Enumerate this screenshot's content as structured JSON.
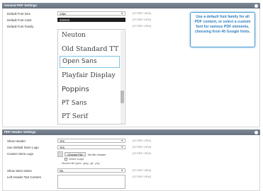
{
  "general": {
    "title": "General PDF Settings",
    "rows": [
      {
        "label": "Default Font Size",
        "value": "14px",
        "scope": "[STORE VIEW]"
      },
      {
        "label": "Default Font Color",
        "value": "333333",
        "scope": "[STORE VIEW]"
      },
      {
        "label": "Default Font Family",
        "scope": "[STORE VIEW]"
      }
    ],
    "font_options": [
      "Neuton",
      "Old Standard TT",
      "Open Sans",
      "Playfair Display",
      "Poppins",
      "PT Sans",
      "PT Serif"
    ],
    "selected_font": "Open Sans",
    "tooltip": "Use a default font family for all PDF content, or select a custom font for various PDF elements, choosing from 40 Google fonts."
  },
  "header": {
    "title": "PDF Header Settings",
    "show_header": {
      "label": "Show Header",
      "value": "Yes",
      "scope": "[STORE VIEW]"
    },
    "default_logo": {
      "label": "Use Default Store Logo",
      "value": "Yes",
      "scope": "[STORE VIEW]"
    },
    "custom_logo": {
      "label": "Custom Store Logo",
      "button": "Choose File",
      "file_text": "No file chosen",
      "delete_label": "Delete Image",
      "allowed": "Allowed file types: .jpeg, .gif, .png",
      "scope": "[STORE VIEW]"
    },
    "store_name": {
      "label": "Show Store Name",
      "value": "No",
      "scope": "[STORE VIEW]"
    },
    "left_text": {
      "label": "Left Header Text Content",
      "scope": "[STORE VIEW]"
    }
  }
}
